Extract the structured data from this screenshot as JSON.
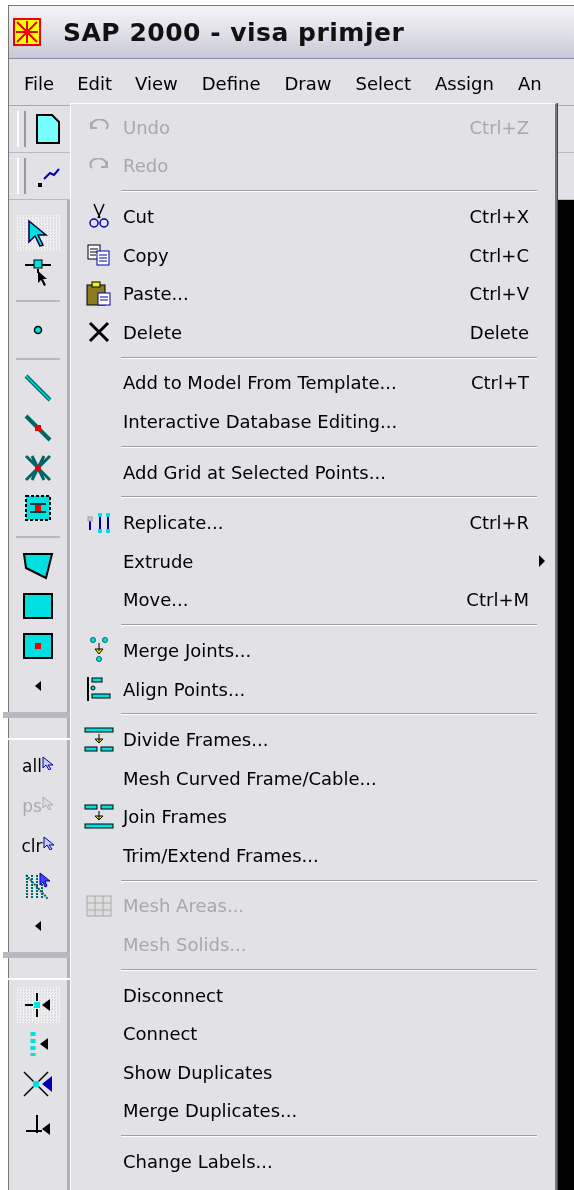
{
  "window": {
    "title": "SAP 2000 - visa primjer"
  },
  "menubar": [
    {
      "label": "File",
      "selected": false
    },
    {
      "label": "Edit",
      "selected": true
    },
    {
      "label": "View",
      "selected": false
    },
    {
      "label": "Define",
      "selected": false
    },
    {
      "label": "Draw",
      "selected": false
    },
    {
      "label": "Select",
      "selected": false
    },
    {
      "label": "Assign",
      "selected": false
    },
    {
      "label": "An",
      "selected": false
    }
  ],
  "left_toolbar": [
    {
      "kind": "icon",
      "selected": true
    },
    {
      "kind": "icon",
      "selected": false
    },
    {
      "kind": "separator"
    },
    {
      "kind": "icon",
      "selected": false
    },
    {
      "kind": "separator"
    },
    {
      "kind": "icon",
      "selected": false
    },
    {
      "kind": "icon",
      "selected": false
    },
    {
      "kind": "icon",
      "selected": false
    },
    {
      "kind": "icon",
      "selected": false
    },
    {
      "kind": "separator"
    },
    {
      "kind": "icon",
      "selected": false
    },
    {
      "kind": "icon",
      "selected": false
    },
    {
      "kind": "icon",
      "selected": false
    },
    {
      "kind": "chevron"
    },
    {
      "kind": "group"
    },
    {
      "kind": "text",
      "label": "all",
      "disabled": false
    },
    {
      "kind": "text",
      "label": "ps",
      "disabled": true
    },
    {
      "kind": "text",
      "label": "clr",
      "disabled": false
    },
    {
      "kind": "icon",
      "selected": false
    },
    {
      "kind": "chevron"
    },
    {
      "kind": "group"
    },
    {
      "kind": "icon",
      "selected": true
    },
    {
      "kind": "icon",
      "selected": false
    },
    {
      "kind": "icon",
      "selected": false
    },
    {
      "kind": "icon",
      "selected": false
    }
  ],
  "edit_menu": [
    {
      "kind": "item",
      "label": "Undo",
      "shortcut": "Ctrl+Z",
      "disabled": true,
      "submenu": false
    },
    {
      "kind": "item",
      "label": "Redo",
      "disabled": true,
      "submenu": false
    },
    {
      "kind": "separator"
    },
    {
      "kind": "item",
      "label": "Cut",
      "shortcut": "Ctrl+X",
      "disabled": false,
      "submenu": false
    },
    {
      "kind": "item",
      "label": "Copy",
      "shortcut": "Ctrl+C",
      "disabled": false,
      "submenu": false
    },
    {
      "kind": "item",
      "label": "Paste...",
      "shortcut": "Ctrl+V",
      "disabled": false,
      "submenu": false
    },
    {
      "kind": "item",
      "label": "Delete",
      "shortcut": "Delete",
      "disabled": false,
      "submenu": false
    },
    {
      "kind": "separator"
    },
    {
      "kind": "item",
      "label": "Add to Model From Template...",
      "shortcut": "Ctrl+T",
      "disabled": false,
      "submenu": false
    },
    {
      "kind": "item",
      "label": "Interactive Database Editing...",
      "disabled": false,
      "submenu": false
    },
    {
      "kind": "separator"
    },
    {
      "kind": "item",
      "label": "Add Grid at Selected Points...",
      "disabled": false,
      "submenu": false
    },
    {
      "kind": "separator"
    },
    {
      "kind": "item",
      "label": "Replicate...",
      "shortcut": "Ctrl+R",
      "disabled": false,
      "submenu": false
    },
    {
      "kind": "item",
      "label": "Extrude",
      "disabled": false,
      "submenu": true
    },
    {
      "kind": "item",
      "label": "Move...",
      "shortcut": "Ctrl+M",
      "disabled": false,
      "submenu": false
    },
    {
      "kind": "separator"
    },
    {
      "kind": "item",
      "label": "Merge Joints...",
      "disabled": false,
      "submenu": false
    },
    {
      "kind": "item",
      "label": "Align Points...",
      "disabled": false,
      "submenu": false
    },
    {
      "kind": "separator"
    },
    {
      "kind": "item",
      "label": "Divide Frames...",
      "disabled": false,
      "submenu": false
    },
    {
      "kind": "item",
      "label": "Mesh Curved Frame/Cable...",
      "disabled": false,
      "submenu": false
    },
    {
      "kind": "item",
      "label": "Join Frames",
      "disabled": false,
      "submenu": false
    },
    {
      "kind": "item",
      "label": "Trim/Extend Frames...",
      "disabled": false,
      "submenu": false
    },
    {
      "kind": "separator"
    },
    {
      "kind": "item",
      "label": "Mesh Areas...",
      "disabled": true,
      "submenu": false
    },
    {
      "kind": "item",
      "label": "Mesh Solids...",
      "disabled": true,
      "submenu": false
    },
    {
      "kind": "separator"
    },
    {
      "kind": "item",
      "label": "Disconnect",
      "disabled": false,
      "submenu": false
    },
    {
      "kind": "item",
      "label": "Connect",
      "disabled": false,
      "submenu": false
    },
    {
      "kind": "item",
      "label": "Show Duplicates",
      "disabled": false,
      "submenu": false
    },
    {
      "kind": "item",
      "label": "Merge Duplicates...",
      "disabled": false,
      "submenu": false
    },
    {
      "kind": "separator"
    },
    {
      "kind": "item",
      "label": "Change Labels...",
      "disabled": false,
      "submenu": false
    }
  ]
}
